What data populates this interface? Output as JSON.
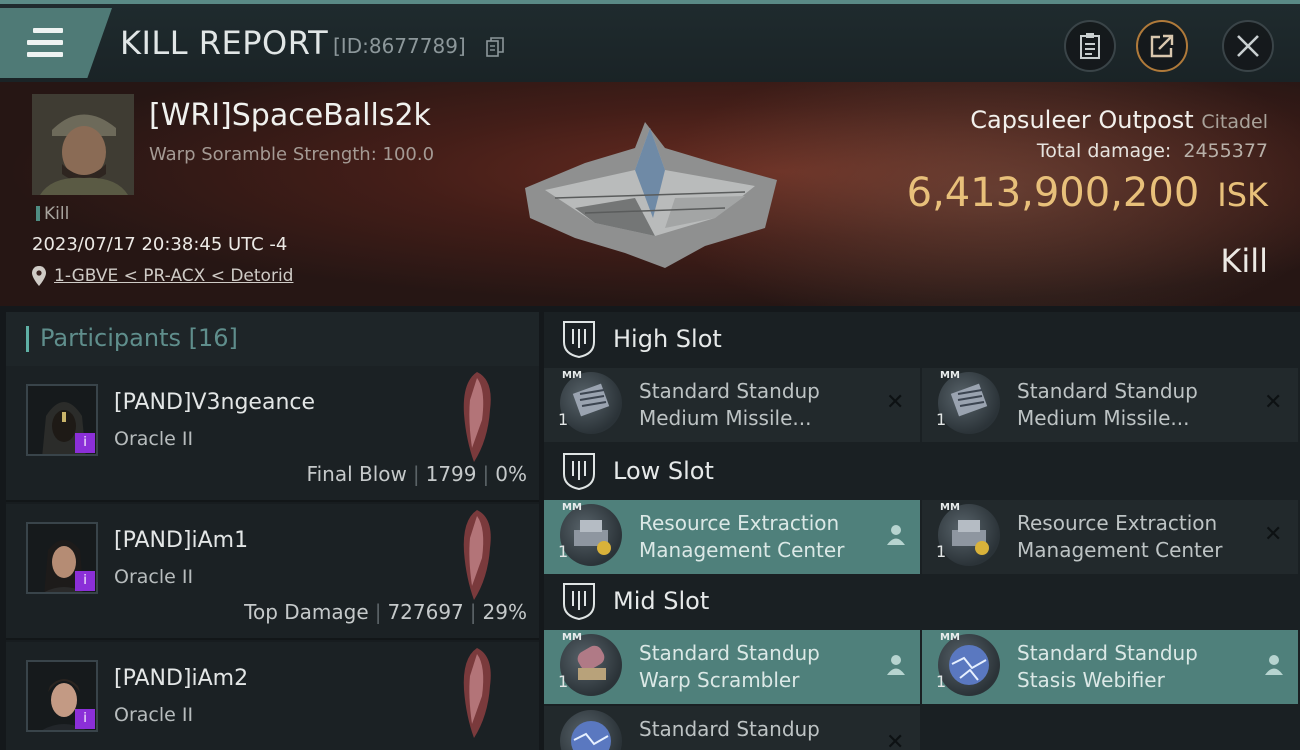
{
  "header": {
    "title": "KILL REPORT",
    "report_id": "[ID:8677789]"
  },
  "summary": {
    "pilot_name": "[WRI]SpaceBalls2k",
    "scramble": "Warp Soramble Strength: 100.0",
    "kill_tag": "Kill",
    "datetime": "2023/07/17 20:38:45 UTC -4",
    "location": "1-GBVE < PR-ACX < Detorid",
    "target_name": "Capsuleer Outpost",
    "target_type": "Citadel",
    "total_damage_label": "Total damage:",
    "total_damage": "2455377",
    "isk_value": "6,413,900,200",
    "isk_unit": "ISK",
    "result": "Kill"
  },
  "participants": {
    "label": "Participants [16]",
    "rows": [
      {
        "name": "[PAND]V3ngeance",
        "ship": "Oracle II",
        "role": "Final Blow",
        "damage": "1799",
        "percent": "0%"
      },
      {
        "name": "[PAND]iAm1",
        "ship": "Oracle II",
        "role": "Top Damage",
        "damage": "727697",
        "percent": "29%"
      },
      {
        "name": "[PAND]iAm2",
        "ship": "Oracle II"
      }
    ]
  },
  "slots": {
    "high": {
      "label": "High Slot",
      "modules": [
        {
          "name_line1": "Standard Standup",
          "name_line2": "Medium Missile...",
          "qty": "1",
          "tag": "MM"
        },
        {
          "name_line1": "Standard Standup",
          "name_line2": "Medium Missile...",
          "qty": "1",
          "tag": "MM"
        }
      ]
    },
    "low": {
      "label": "Low Slot",
      "modules": [
        {
          "name_line1": "Resource Extraction",
          "name_line2": "Management Center",
          "qty": "1",
          "tag": "MM"
        },
        {
          "name_line1": "Resource Extraction",
          "name_line2": "Management Center",
          "qty": "1",
          "tag": "MM"
        }
      ]
    },
    "mid": {
      "label": "Mid Slot",
      "modules": [
        {
          "name_line1": "Standard Standup",
          "name_line2": "Warp Scrambler",
          "qty": "1",
          "tag": "MM"
        },
        {
          "name_line1": "Standard Standup",
          "name_line2": "Stasis Webifier",
          "qty": "1",
          "tag": "MM"
        },
        {
          "name_line1": "Standard Standup"
        }
      ]
    }
  },
  "colors": {
    "accent_teal": "#4f807b",
    "isk_gold": "#e8c07a",
    "badge_purple": "#8b2fd8"
  },
  "icons": {
    "menu": "hamburger-icon",
    "copy": "copy-icon",
    "clipboard": "clipboard-icon",
    "share": "share-icon",
    "close": "close-icon",
    "location": "map-pin-icon",
    "slot": "slot-shield-icon",
    "remove": "x-icon",
    "pilot": "person-icon"
  }
}
